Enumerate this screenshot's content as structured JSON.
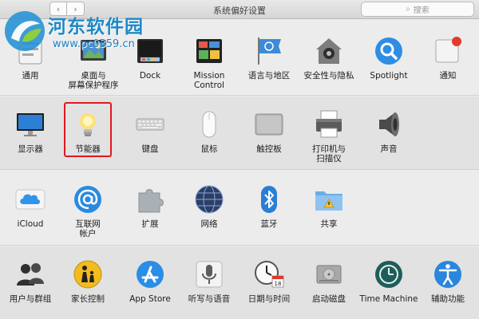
{
  "window": {
    "title": "系统偏好设置",
    "back": "‹",
    "forward": "›",
    "search_placeholder": "搜索"
  },
  "watermark": {
    "line1": "河东软件园",
    "line2": "www.pc0359.cn"
  },
  "rows": [
    {
      "items": [
        {
          "label": "通用"
        },
        {
          "label": "桌面与\n屏幕保护程序"
        },
        {
          "label": "Dock"
        },
        {
          "label": "Mission\nControl"
        },
        {
          "label": "语言与地区"
        },
        {
          "label": "安全性与隐私"
        },
        {
          "label": "Spotlight"
        },
        {
          "label": "通知"
        }
      ]
    },
    {
      "items": [
        {
          "label": "显示器"
        },
        {
          "label": "节能器"
        },
        {
          "label": "键盘"
        },
        {
          "label": "鼠标"
        },
        {
          "label": "触控板"
        },
        {
          "label": "打印机与\n扫描仪"
        },
        {
          "label": "声音"
        }
      ]
    },
    {
      "items": [
        {
          "label": "iCloud"
        },
        {
          "label": "互联网\n帐户"
        },
        {
          "label": "扩展"
        },
        {
          "label": "网络"
        },
        {
          "label": "蓝牙"
        },
        {
          "label": "共享"
        }
      ]
    },
    {
      "items": [
        {
          "label": "用户与群组"
        },
        {
          "label": "家长控制"
        },
        {
          "label": "App Store"
        },
        {
          "label": "听写与语音"
        },
        {
          "label": "日期与时间"
        },
        {
          "label": "启动磁盘"
        },
        {
          "label": "Time Machine"
        },
        {
          "label": "辅助功能"
        }
      ]
    }
  ],
  "calendar_icon_day": "18",
  "highlighted_pane": "节能器",
  "colors": {
    "highlight": "#e0191f",
    "accent_blue": "#1e88c7"
  }
}
